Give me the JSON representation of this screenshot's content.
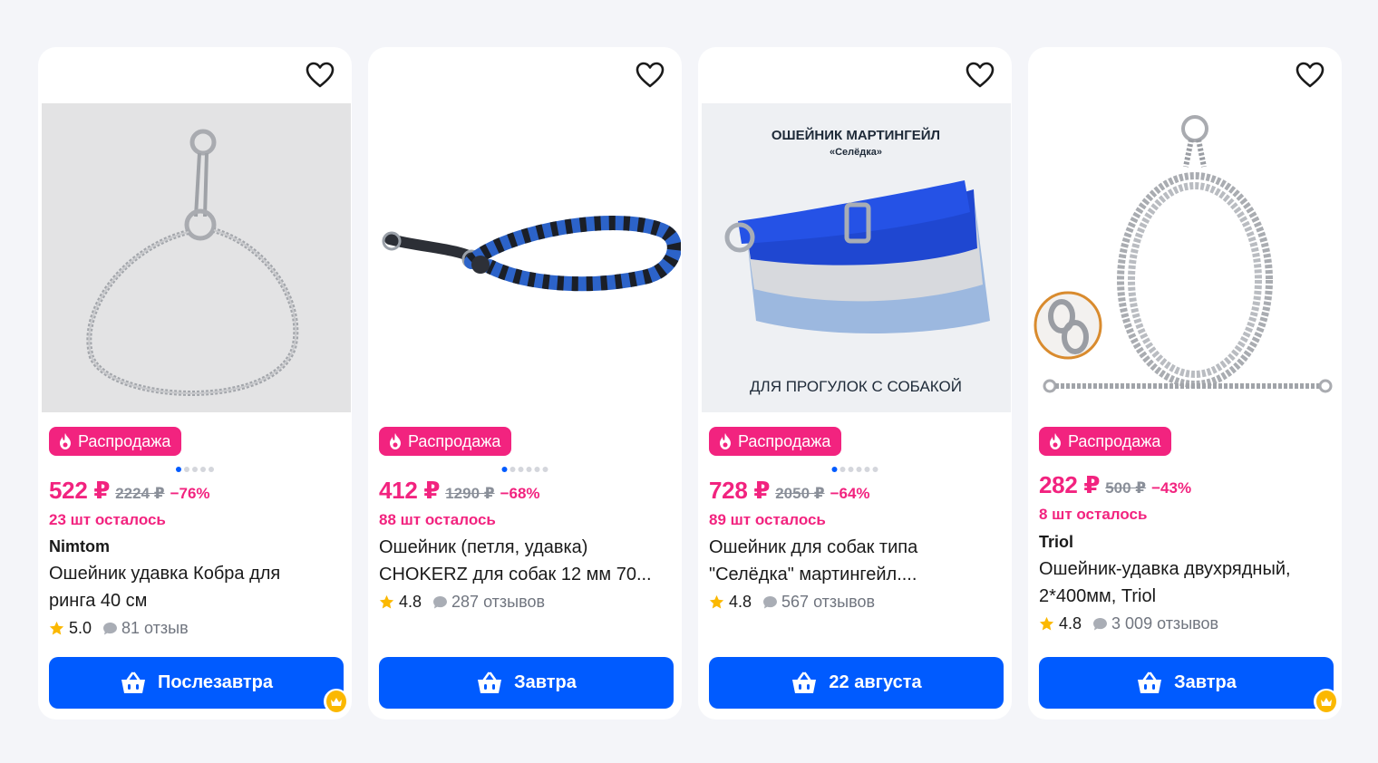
{
  "colors": {
    "accent": "#005bff",
    "sale": "#f2237f",
    "muted": "#8a8f99",
    "star": "#fbb800"
  },
  "products": [
    {
      "sale_label": "Распродажа",
      "price": "522 ₽",
      "old_price": "2224 ₽",
      "discount": "−76%",
      "stock": "23 шт осталось",
      "brand": "Nimtom",
      "title": "Ошейник удавка Кобра для ринга 40 см",
      "rating": "5.0",
      "reviews": "81 отзыв",
      "button": "Послезавтра",
      "image_icon": "snake-chain-collar",
      "has_crown": true
    },
    {
      "sale_label": "Распродажа",
      "price": "412 ₽",
      "old_price": "1290 ₽",
      "discount": "−68%",
      "stock": "88 шт осталось",
      "brand": "",
      "title": "Ошейник (петля, удавка) CHOKERZ для собак 12 мм 70...",
      "rating": "4.8",
      "reviews": "287 отзывов",
      "button": "Завтра",
      "image_icon": "rope-slip-collar",
      "has_crown": false
    },
    {
      "sale_label": "Распродажа",
      "price": "728 ₽",
      "old_price": "2050 ₽",
      "discount": "−64%",
      "stock": "89 шт осталось",
      "brand": "",
      "title": "Ошейник для собак типа \"Селёдка\" мартингейл....",
      "rating": "4.8",
      "reviews": "567 отзывов",
      "button": "22 августа",
      "image_icon": "martingale-collar",
      "image_heading": "ОШЕЙНИК МАРТИНГЕЙЛ",
      "image_subheading": "«Селёдка»",
      "image_caption": "ДЛЯ ПРОГУЛОК С СОБАКОЙ",
      "has_crown": false
    },
    {
      "sale_label": "Распродажа",
      "price": "282 ₽",
      "old_price": "500 ₽",
      "discount": "−43%",
      "stock": "8 шт осталось",
      "brand": "Triol",
      "title": "Ошейник-удавка двухрядный, 2*400мм, Triol",
      "rating": "4.8",
      "reviews": "3 009 отзывов",
      "button": "Завтра",
      "image_icon": "double-chain-choke",
      "has_crown": true
    }
  ]
}
